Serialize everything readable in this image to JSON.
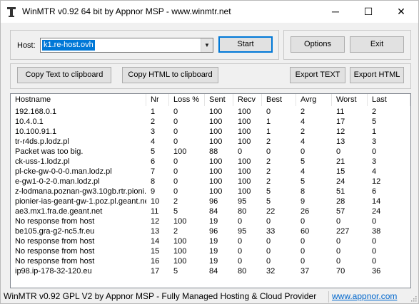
{
  "window": {
    "title": "WinMTR v0.92 64 bit by Appnor MSP - www.winmtr.net",
    "minimize_glyph": "─",
    "maximize_glyph": "☐",
    "close_glyph": "✕"
  },
  "host": {
    "label": "Host:",
    "value": "k1.re-host.ovh",
    "dropdown_icon": "chevron-down-icon"
  },
  "buttons": {
    "start": "Start",
    "options": "Options",
    "exit": "Exit",
    "copy_text": "Copy Text to clipboard",
    "copy_html": "Copy HTML to clipboard",
    "export_text": "Export TEXT",
    "export_html": "Export HTML"
  },
  "table": {
    "columns": [
      "Hostname",
      "Nr",
      "Loss %",
      "Sent",
      "Recv",
      "Best",
      "Avrg",
      "Worst",
      "Last"
    ],
    "rows": [
      [
        "192.168.0.1",
        "1",
        "0",
        "100",
        "100",
        "0",
        "2",
        "11",
        "2"
      ],
      [
        "10.4.0.1",
        "2",
        "0",
        "100",
        "100",
        "1",
        "4",
        "17",
        "5"
      ],
      [
        "10.100.91.1",
        "3",
        "0",
        "100",
        "100",
        "1",
        "2",
        "12",
        "1"
      ],
      [
        "tr-r4ds.p.lodz.pl",
        "4",
        "0",
        "100",
        "100",
        "2",
        "4",
        "13",
        "3"
      ],
      [
        "Packet was too big.",
        "5",
        "100",
        "88",
        "0",
        "0",
        "0",
        "0",
        "0"
      ],
      [
        "ck-uss-1.lodz.pl",
        "6",
        "0",
        "100",
        "100",
        "2",
        "5",
        "21",
        "3"
      ],
      [
        "pl-cke-gw-0-0-0.man.lodz.pl",
        "7",
        "0",
        "100",
        "100",
        "2",
        "4",
        "15",
        "4"
      ],
      [
        "e-gw1-0-2-0.man.lodz.pl",
        "8",
        "0",
        "100",
        "100",
        "2",
        "5",
        "24",
        "12"
      ],
      [
        "z-lodmana.poznan-gw3.10gb.rtr.pioni...",
        "9",
        "0",
        "100",
        "100",
        "5",
        "8",
        "51",
        "6"
      ],
      [
        "pionier-ias-geant-gw-1.poz.pl.geant.net",
        "10",
        "2",
        "96",
        "95",
        "5",
        "9",
        "28",
        "14"
      ],
      [
        "ae3.mx1.fra.de.geant.net",
        "11",
        "5",
        "84",
        "80",
        "22",
        "26",
        "57",
        "24"
      ],
      [
        "No response from host",
        "12",
        "100",
        "19",
        "0",
        "0",
        "0",
        "0",
        "0"
      ],
      [
        "be105.gra-g2-nc5.fr.eu",
        "13",
        "2",
        "96",
        "95",
        "33",
        "60",
        "227",
        "38"
      ],
      [
        "No response from host",
        "14",
        "100",
        "19",
        "0",
        "0",
        "0",
        "0",
        "0"
      ],
      [
        "No response from host",
        "15",
        "100",
        "19",
        "0",
        "0",
        "0",
        "0",
        "0"
      ],
      [
        "No response from host",
        "16",
        "100",
        "19",
        "0",
        "0",
        "0",
        "0",
        "0"
      ],
      [
        "ip98.ip-178-32-120.eu",
        "17",
        "5",
        "84",
        "80",
        "32",
        "37",
        "70",
        "36"
      ]
    ]
  },
  "status": {
    "text": "WinMTR v0.92 GPL V2 by Appnor MSP - Fully Managed Hosting & Cloud Provider",
    "link": "www.appnor.com"
  },
  "colors": {
    "selection": "#0078d7",
    "link": "#0066cc",
    "window_bg": "#f0f0f0"
  }
}
